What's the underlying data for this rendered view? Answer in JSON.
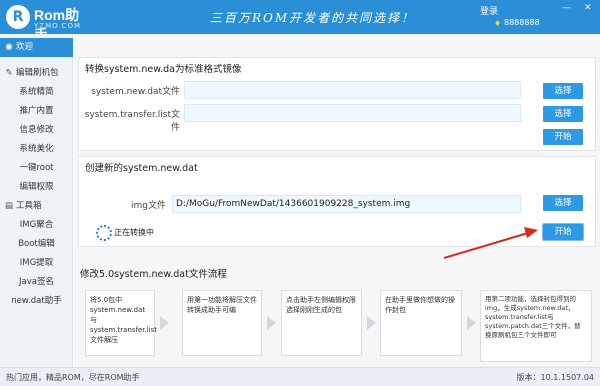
{
  "header": {
    "logo_badge": "R",
    "logo_name": "Rom助手",
    "logo_url": "YZMO.COM",
    "slogan": "三百万ROM开发者的共同选择！",
    "login_label": "登录",
    "vip_icon": "♦",
    "user_id": "8888888",
    "window_controls": [
      "—",
      "✕"
    ]
  },
  "sidebar": {
    "home": {
      "icon": "globe-icon",
      "label": "欢迎"
    },
    "group1": {
      "icon": "pen-icon",
      "label": "编辑刷机包"
    },
    "group1_items": [
      "系统精简",
      "推广内置",
      "信息修改",
      "系统美化",
      "一键root",
      "编辑权限"
    ],
    "group2": {
      "icon": "toolbox-icon",
      "label": "工具箱"
    },
    "group2_items": [
      "IMG聚合",
      "Boot编辑",
      "IMG提取",
      "Java签名",
      "new.dat助手"
    ]
  },
  "convert_panel": {
    "title": "转换system.new.da为标准格式镜像",
    "rows": [
      {
        "label": "system.new.dat文件",
        "value": "",
        "button": "选择"
      },
      {
        "label": "system.transfer.list文件",
        "value": "",
        "button": "选择"
      }
    ],
    "start_button": "开始"
  },
  "create_panel": {
    "title": "创建新的system.new.dat",
    "img_label": "img文件",
    "img_value": "D:/MoGu/FromNewDat/1436601909228_system.img",
    "select_button": "选择",
    "status_text": "正在转换中",
    "start_button": "开始"
  },
  "flow": {
    "title": "修改5.0system.new.dat文件流程",
    "steps": [
      "将5.0包中system.new.dat与system.transfer.list文件解压",
      "用第一功能将解压文件转换成助手可编",
      "点击助手左侧编辑权限选择刚刚生成的包",
      "在助手里做你想做的操作封包",
      "用第二项功能，选择封包得到的img，生成system.new.dat，system.transfer.list与system.patch.dat三个文件，替换原刷机包三个文件即可"
    ]
  },
  "footer": {
    "left": "热门应用，精品ROM，尽在ROM助手",
    "right": "版本：10.1.1507.04"
  },
  "colors": {
    "brand": "#2b8fd8",
    "button": "#2e9ae6",
    "arrow": "#d9291c"
  }
}
